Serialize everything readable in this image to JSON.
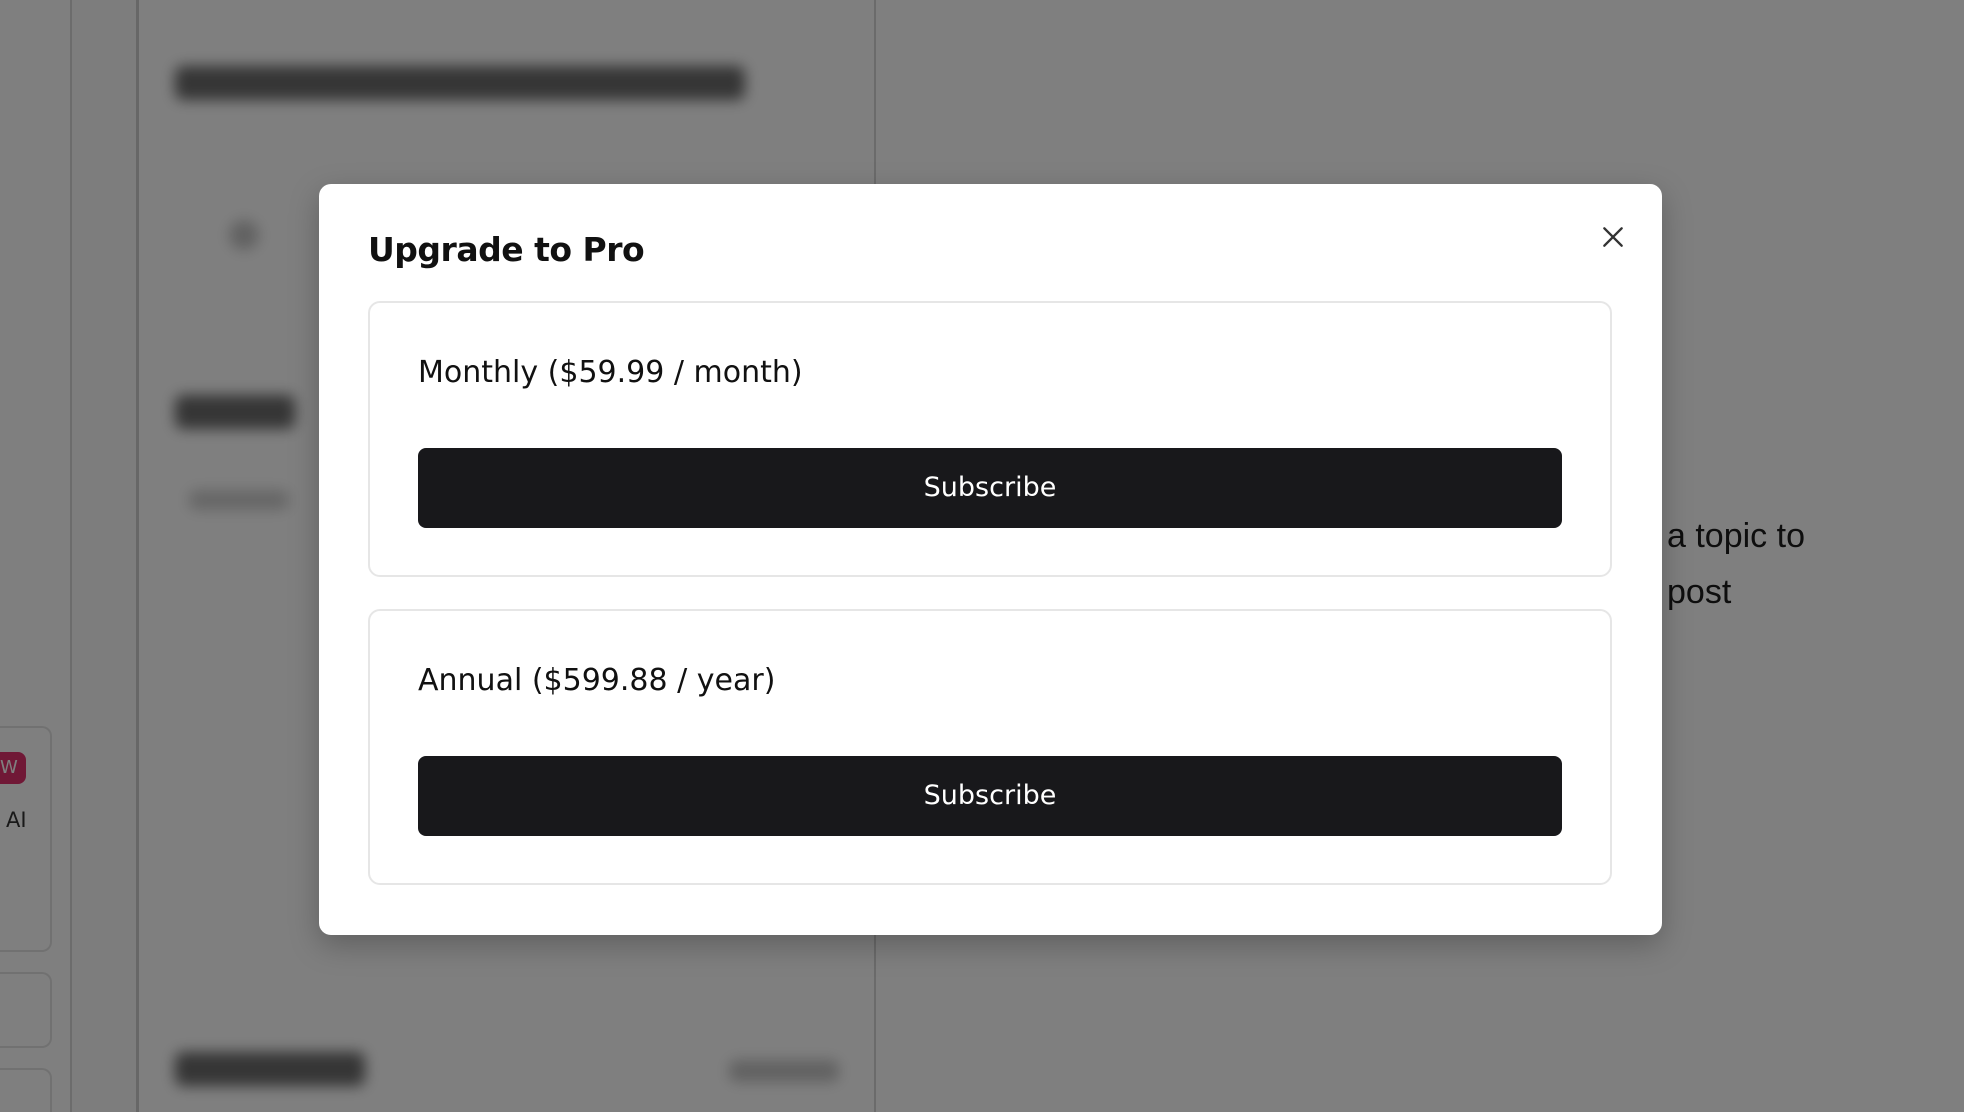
{
  "background": {
    "badge_text": "W",
    "sidebar_label": "AI",
    "hint_line_1": "a topic to",
    "hint_line_2": "post"
  },
  "modal": {
    "title": "Upgrade to Pro",
    "close_icon": "close-icon",
    "plans": [
      {
        "label": "Monthly ($59.99 / month)",
        "button_label": "Subscribe"
      },
      {
        "label": "Annual ($599.88 / year)",
        "button_label": "Subscribe"
      }
    ]
  },
  "colors": {
    "overlay": "#808080",
    "button_bg": "#18181b",
    "badge": "#e0306c"
  }
}
